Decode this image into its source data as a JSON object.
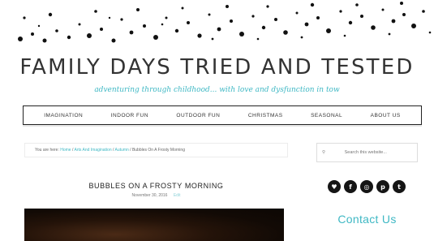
{
  "header": {
    "site_title": "FAMILY DAYS TRIED AND TESTED",
    "tagline": "adventuring through childhood... with love and dysfunction in tow"
  },
  "nav": {
    "items": [
      {
        "label": "IMAGINATION"
      },
      {
        "label": "INDOOR FUN"
      },
      {
        "label": "OUTDOOR FUN"
      },
      {
        "label": "CHRISTMAS"
      },
      {
        "label": "SEASONAL"
      },
      {
        "label": "ABOUT US"
      }
    ]
  },
  "breadcrumb": {
    "prefix": "You are here:",
    "links": [
      "Home",
      "Arts And Imagination",
      "Autumn"
    ],
    "current": "Bubbles On A Frosty Morning"
  },
  "search": {
    "placeholder": "Search this website..."
  },
  "post": {
    "title": "BUBBLES ON A FROSTY MORNING",
    "date": "November 30, 2016",
    "edit_label": "Edit"
  },
  "sidebar": {
    "social": [
      {
        "icon": "bloglovin-icon",
        "glyph": "♥"
      },
      {
        "icon": "facebook-icon",
        "glyph": "f"
      },
      {
        "icon": "instagram-icon",
        "glyph": "◎"
      },
      {
        "icon": "pinterest-icon",
        "glyph": "p"
      },
      {
        "icon": "twitter-icon",
        "glyph": "t"
      }
    ],
    "contact_label": "Contact Us"
  },
  "colors": {
    "accent": "#3fb8c4",
    "text": "#333333"
  }
}
